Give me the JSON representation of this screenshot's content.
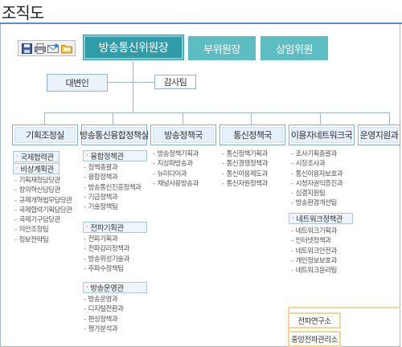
{
  "page": {
    "title": "조직도"
  },
  "toolbar": {
    "icons": [
      "save-icon",
      "print-icon",
      "email-icon",
      "folder-icon"
    ]
  },
  "top": {
    "chairman": "방송통신위원장",
    "vice": "부위원장",
    "commissioner": "상임위원"
  },
  "sub": {
    "spokesperson": "대변인",
    "audit": "감사팀"
  },
  "departments": [
    {
      "label": "기획조정실",
      "groups": [
        {
          "label": "국제협력관",
          "items": []
        },
        {
          "label": "비상계획관",
          "items": [
            "기획재정담당관",
            "창의혁신담당관",
            "규제개혁법무담당관",
            "국제협력기획담당관",
            "국제기구담당관",
            "의안조정팀",
            "정보전략팀"
          ]
        }
      ]
    },
    {
      "label": "방송통신융합정책실",
      "groups": [
        {
          "label": "융합정책관",
          "items": [
            "정책총괄과",
            "융합정책과",
            "방송통신진흥정책과",
            "기금정책과",
            "기술정책팀"
          ]
        },
        {
          "label": "전파기획관",
          "items": [
            "전파기획과",
            "전파감리정책과",
            "방송위성기술과",
            "주파수정책팀"
          ]
        },
        {
          "label": "방송운영관",
          "items": [
            "방송운영과",
            "디지털전환과",
            "편성정책과",
            "평가분석과"
          ]
        }
      ]
    },
    {
      "label": "방송정책국",
      "groups": [
        {
          "label": "",
          "items": [
            "방송정책기획과",
            "지상파방송과",
            "뉴미디어과",
            "채널사용방송과"
          ]
        }
      ]
    },
    {
      "label": "통신정책국",
      "groups": [
        {
          "label": "",
          "items": [
            "통신정책기획과",
            "통신경쟁정책과",
            "통신이용제도과",
            "통신자원정책과"
          ]
        }
      ]
    },
    {
      "label": "이용자네트워크국",
      "groups": [
        {
          "label": "",
          "items": [
            "조사기획총괄과",
            "시장조사과",
            "통신이용자보호과",
            "시청자권익증진과",
            "심결지원팀",
            "방송환경개선팀"
          ]
        },
        {
          "label": "네트워크정책관",
          "items": [
            "네트워크기획과",
            "인터넷정책과",
            "네트워크안전과",
            "개인정보보호과",
            "네트워크윤리팀"
          ]
        }
      ]
    },
    {
      "label": "운영지원과",
      "groups": []
    }
  ],
  "agencies": {
    "radio_research": "전파연구소",
    "central_radio": "중앙전파관리소"
  }
}
